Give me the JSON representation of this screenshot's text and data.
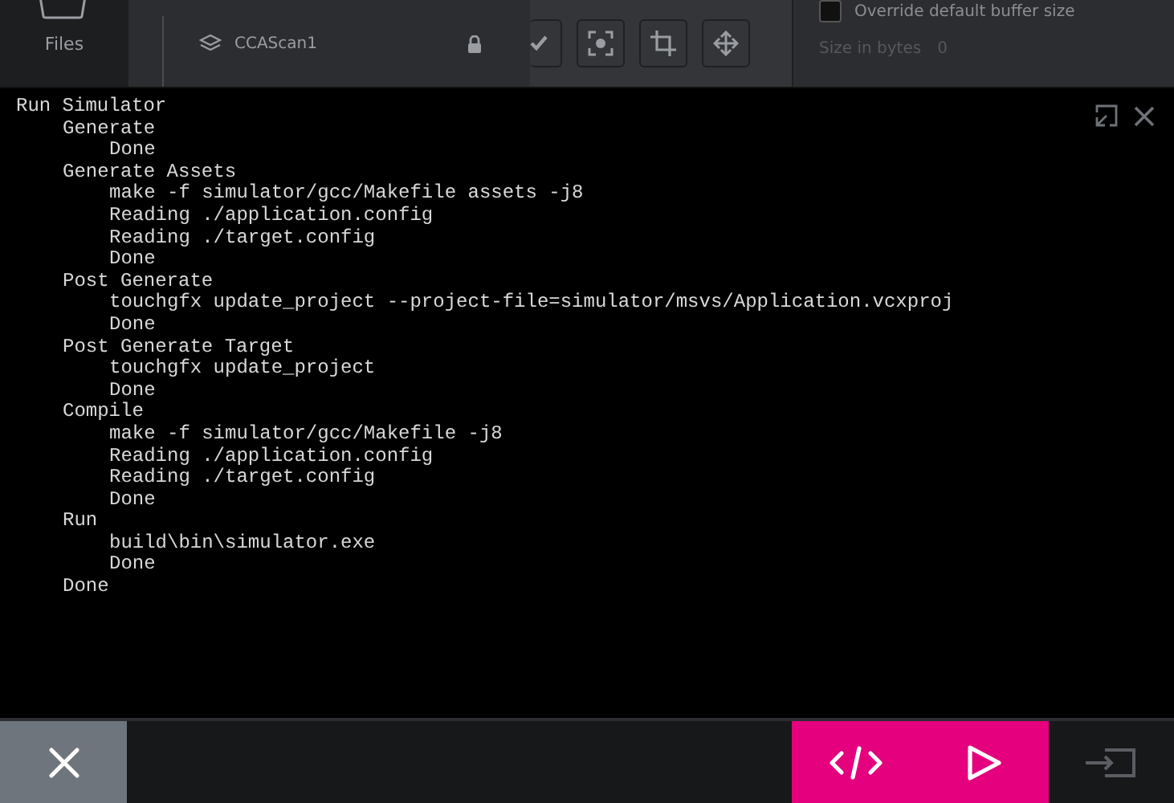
{
  "nav": {
    "label": "Files"
  },
  "tree": {
    "item": "CCAScan1"
  },
  "properties": {
    "checkbox": {
      "label": "Override default buffer size",
      "checked": false
    },
    "size": {
      "label": "Size in bytes",
      "value": "0"
    }
  },
  "console": {
    "lines": [
      {
        "text": "Run Simulator",
        "children": [
          {
            "text": "Generate",
            "children": [
              {
                "text": "Done"
              }
            ]
          },
          {
            "text": "Generate Assets",
            "children": [
              {
                "text": "make -f simulator/gcc/Makefile assets -j8"
              },
              {
                "text": "Reading ./application.config"
              },
              {
                "text": "Reading ./target.config"
              },
              {
                "text": "Done"
              }
            ]
          },
          {
            "text": "Post Generate",
            "children": [
              {
                "text": "touchgfx update_project --project-file=simulator/msvs/Application.vcxproj"
              },
              {
                "text": "Done"
              }
            ]
          },
          {
            "text": "Post Generate Target",
            "children": [
              {
                "text": "touchgfx update_project"
              },
              {
                "text": "Done"
              }
            ]
          },
          {
            "text": "Compile",
            "children": [
              {
                "text": "make -f simulator/gcc/Makefile -j8"
              },
              {
                "text": "Reading ./application.config"
              },
              {
                "text": "Reading ./target.config"
              },
              {
                "text": "Done"
              }
            ]
          },
          {
            "text": "Run",
            "children": [
              {
                "text": "build\\bin\\simulator.exe"
              },
              {
                "text": "Done"
              }
            ]
          },
          {
            "text": "Done"
          }
        ]
      }
    ]
  }
}
